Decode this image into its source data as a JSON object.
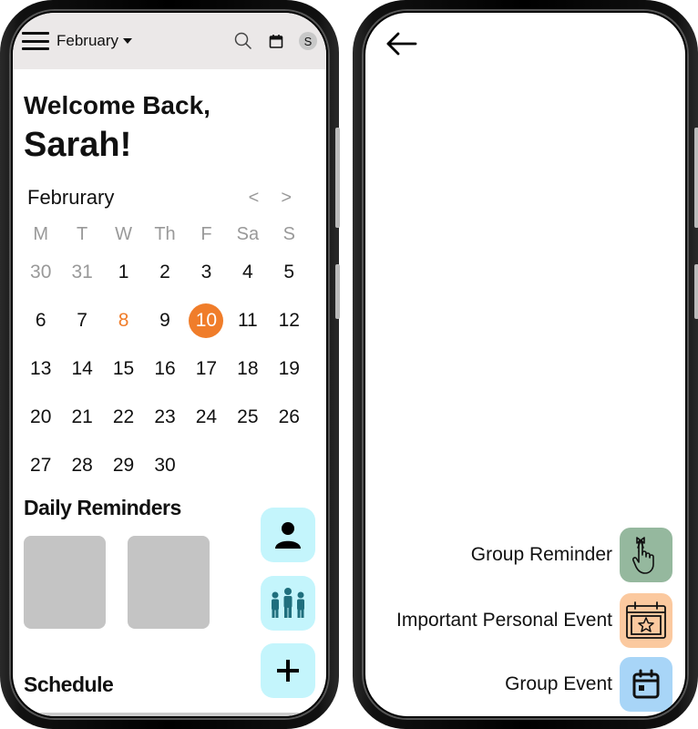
{
  "header": {
    "month": "February",
    "avatar_initial": "S"
  },
  "welcome": {
    "line1": "Welcome Back,",
    "line2": "Sarah!"
  },
  "calendar": {
    "title": "Februrary",
    "prev": "<",
    "next": ">",
    "weekdays": [
      "M",
      "T",
      "W",
      "Th",
      "F",
      "Sa",
      "S"
    ],
    "days": [
      {
        "d": "30",
        "s": "muted"
      },
      {
        "d": "31",
        "s": "muted"
      },
      {
        "d": "1"
      },
      {
        "d": "2"
      },
      {
        "d": "3"
      },
      {
        "d": "4"
      },
      {
        "d": "5"
      },
      {
        "d": "6"
      },
      {
        "d": "7"
      },
      {
        "d": "8",
        "s": "accent"
      },
      {
        "d": "9"
      },
      {
        "d": "10",
        "s": "selected"
      },
      {
        "d": "11"
      },
      {
        "d": "12"
      },
      {
        "d": "13"
      },
      {
        "d": "14"
      },
      {
        "d": "15"
      },
      {
        "d": "16"
      },
      {
        "d": "17"
      },
      {
        "d": "18"
      },
      {
        "d": "19"
      },
      {
        "d": "20"
      },
      {
        "d": "21"
      },
      {
        "d": "22"
      },
      {
        "d": "23"
      },
      {
        "d": "24"
      },
      {
        "d": "25"
      },
      {
        "d": "26"
      },
      {
        "d": "27"
      },
      {
        "d": "28"
      },
      {
        "d": "29"
      },
      {
        "d": "30"
      }
    ],
    "accent_color": "#f07d2a"
  },
  "sections": {
    "daily_reminders": "Daily Reminders",
    "schedule": "Schedule"
  },
  "fab": {
    "person_icon": "person-icon",
    "group_icon": "group-icon",
    "add_icon": "plus-icon",
    "color": "#c4f5fc"
  },
  "options": [
    {
      "label": "Group Reminder",
      "icon": "finger-ribbon-icon",
      "color": "#95b89e"
    },
    {
      "label": "Important Personal Event",
      "icon": "calendar-star-icon",
      "color": "#fbc99f"
    },
    {
      "label": "Group Event",
      "icon": "calendar-icon",
      "color": "#a8d5f7"
    }
  ]
}
